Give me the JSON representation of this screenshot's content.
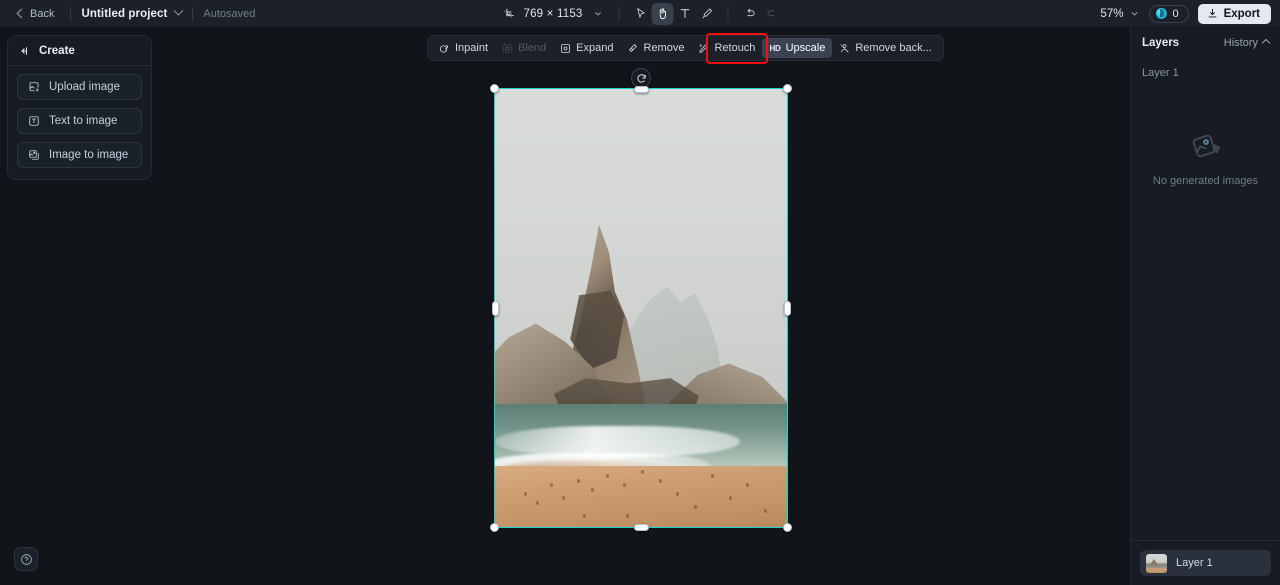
{
  "topbar": {
    "back_label": "Back",
    "project_name": "Untitled project",
    "autosaved_label": "Autosaved",
    "canvas_size": "769 × 1153",
    "zoom_level": "57%",
    "credits_count": "0",
    "export_label": "Export",
    "tools": [
      {
        "name": "crop-frame-icon",
        "label": "Canvas size",
        "active": false
      },
      {
        "name": "select-tool",
        "label": "Select",
        "active": false
      },
      {
        "name": "hand-tool",
        "label": "Hand",
        "active": true
      },
      {
        "name": "text-tool",
        "label": "Text",
        "active": false
      },
      {
        "name": "brush-tool",
        "label": "Brush",
        "active": false
      },
      {
        "name": "undo-button",
        "label": "Undo",
        "active": false
      },
      {
        "name": "redo-button",
        "label": "Redo",
        "active": false
      }
    ]
  },
  "sidebar": {
    "title": "Create",
    "items": [
      {
        "label": "Upload image",
        "icon": "upload-image-icon"
      },
      {
        "label": "Text to image",
        "icon": "text-to-image-icon"
      },
      {
        "label": "Image to image",
        "icon": "image-to-image-icon"
      }
    ]
  },
  "context_toolbar": {
    "highlight_color": "#f2110f",
    "buttons": [
      {
        "label": "Inpaint",
        "icon": "inpaint-icon",
        "state": "normal"
      },
      {
        "label": "Blend",
        "icon": "blend-icon",
        "state": "disabled"
      },
      {
        "label": "Expand",
        "icon": "expand-icon",
        "state": "normal"
      },
      {
        "label": "Remove",
        "icon": "remove-icon",
        "state": "normal"
      },
      {
        "label": "Retouch",
        "icon": "retouch-icon",
        "state": "normal"
      },
      {
        "label": "Upscale",
        "icon": "hd-icon",
        "state": "selected"
      },
      {
        "label": "Remove back...",
        "icon": "remove-background-icon",
        "state": "normal"
      }
    ]
  },
  "canvas": {
    "selection_color": "#19d7cd",
    "rotate_handle": "rotate-icon",
    "background": "#111419"
  },
  "right_panel": {
    "title": "Layers",
    "history_label": "History",
    "current_layer_label": "Layer 1",
    "empty_state_label": "No generated images",
    "empty_state_icon": "image-placeholder-icon",
    "layers": [
      {
        "name": "Layer 1"
      }
    ]
  },
  "help": {
    "icon": "help-circle-icon",
    "label": "Help"
  }
}
